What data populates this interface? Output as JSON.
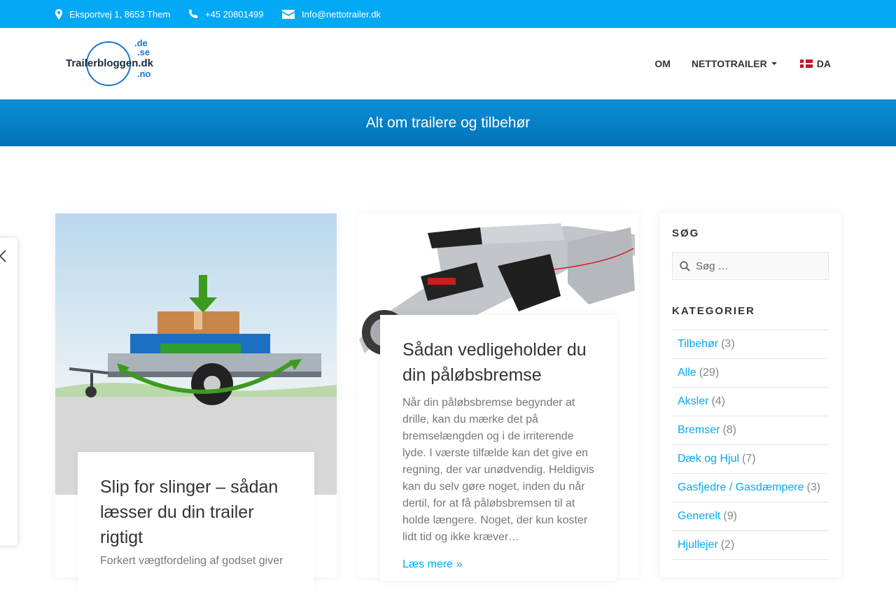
{
  "topbar": {
    "address": "Eksportvej 1, 8653 Them",
    "phone": "+45 20801499",
    "email": "Info@nettotrailer.dk"
  },
  "header": {
    "logo_main": "Trailerbloggen.dk",
    "logo_de": ".de",
    "logo_se": ".se",
    "logo_no": ".no",
    "nav": [
      {
        "label": "OM"
      },
      {
        "label": "NETTOTRAILER"
      },
      {
        "label": "DA"
      }
    ]
  },
  "banner": {
    "title": "Alt om trailere og tilbehør"
  },
  "posts": [
    {
      "title": "Slip for slinger – sådan læsser du din trailer rigtigt",
      "excerpt": "Forkert vægtfordeling af godset giver"
    },
    {
      "title": "Sådan vedligeholder du din påløbsbremse",
      "excerpt": "Når din påløbsbremse begynder at drille, kan du mærke det på bremselængden og i de irriterende lyde. I værste tilfælde kan det give en regning, der var unødvendig. Heldigvis kan du selv gøre noget, inden du når dertil, for at få påløbsbremsen til at holde længere. Noget, der kun koster lidt tid og ikke kræver…",
      "read_more": "Læs mere »"
    }
  ],
  "sidebar": {
    "search_heading": "SØG",
    "search_placeholder": "Søg …",
    "categories_heading": "KATEGORIER",
    "categories": [
      {
        "name": "Tilbehør",
        "count": "(3)"
      },
      {
        "name": "Alle",
        "count": "(29)"
      },
      {
        "name": "Aksler",
        "count": "(4)"
      },
      {
        "name": "Bremser",
        "count": "(8)"
      },
      {
        "name": "Dæk og Hjul",
        "count": "(7)"
      },
      {
        "name": "Gasfjedre / Gasdæmpere",
        "count": "(3)"
      },
      {
        "name": "Generelt",
        "count": "(9)"
      },
      {
        "name": "Hjullejer",
        "count": "(2)"
      }
    ]
  },
  "colors": {
    "accent": "#03a9f4",
    "banner": "#0472b8"
  }
}
